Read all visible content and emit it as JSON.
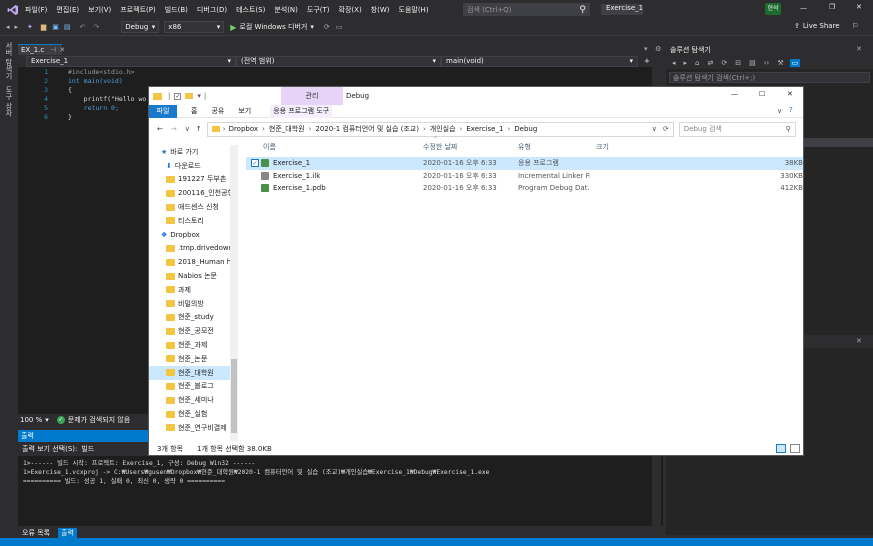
{
  "vs": {
    "menu": [
      "파일(F)",
      "편집(E)",
      "보기(V)",
      "프로젝트(P)",
      "빌드(B)",
      "디버그(D)",
      "테스트(S)",
      "분석(N)",
      "도구(T)",
      "확장(X)",
      "창(W)",
      "도움말(H)"
    ],
    "search_placeholder": "검색 (Ctrl+Q)",
    "solution_name": "Exercise_1",
    "user_badge": "현석",
    "live_share": "Live Share",
    "config": "Debug",
    "platform": "x86",
    "run_label": "로컬 Windows 디버거",
    "left_tabs": [
      "서버 탐색기",
      "도구 상자"
    ],
    "doc_tab": "EX_1.c",
    "nav_project": "Exercise_1",
    "nav_scope": "(전역 범위)",
    "nav_member": "main(void)",
    "line_numbers": [
      "1",
      "2",
      "3",
      "4",
      "5",
      "6"
    ],
    "code": [
      "#include<stdio.h>",
      "int main(void)",
      "{",
      "    printf(\"Hello wo",
      "    return 0;",
      "}"
    ],
    "zoom": "100 %",
    "issues": "문제가 검색되지 않음",
    "output_title": "출력",
    "output_source_label": "출력 보기 선택(S):",
    "output_source": "빌드",
    "output_lines": [
      "1>------ 빌드 시작: 프로젝트: Exercise_1, 구성: Debug Win32 ------",
      "1>Exercise_1.vcxproj -> C:₩Users₩gusen₩Dropbox₩현준_대학원₩2020-1 컴퓨터언어 및 실습 (조교)₩개인실습₩Exercise_1₩Debug₩Exercise_1.exe",
      "========== 빌드: 성공 1, 실패 0, 최신 0, 생략 0 =========="
    ],
    "bottom_tabs": [
      "오류 목록",
      "출력"
    ],
    "sol_title": "솔루션 탐색기",
    "sol_search": "솔루션 탐색기 검색(Ctrl+;)"
  },
  "explorer": {
    "title": "Debug",
    "context_tab": "관리",
    "context_sub": "응용 프로그램 도구",
    "ribbon_tabs": [
      "파일",
      "홈",
      "공유",
      "보기"
    ],
    "breadcrumb": [
      "Dropbox",
      "현준_대학원",
      "2020-1 컴퓨터언어 및 실습 (조교)",
      "개인실습",
      "Exercise_1",
      "Debug"
    ],
    "search_placeholder": "Debug 검색",
    "nav": [
      {
        "label": "바로 가기",
        "kind": "star"
      },
      {
        "label": "다운로드",
        "kind": "download"
      },
      {
        "label": "191227 두부촌",
        "kind": "folder"
      },
      {
        "label": "200116_인천공항",
        "kind": "folder"
      },
      {
        "label": "애드센스 신청",
        "kind": "folder"
      },
      {
        "label": "티스토리",
        "kind": "folder"
      },
      {
        "label": "Dropbox",
        "kind": "dropbox"
      },
      {
        "label": ".tmp.drivedownload",
        "kind": "folder"
      },
      {
        "label": "2018_Human hair",
        "kind": "folder"
      },
      {
        "label": "Nabios 논문",
        "kind": "folder"
      },
      {
        "label": "과제",
        "kind": "folder"
      },
      {
        "label": "비밀의방",
        "kind": "folder"
      },
      {
        "label": "현준_study",
        "kind": "folder"
      },
      {
        "label": "현준_공모전",
        "kind": "folder"
      },
      {
        "label": "현준_과제",
        "kind": "folder"
      },
      {
        "label": "현준_논문",
        "kind": "folder"
      },
      {
        "label": "현준_대학원",
        "kind": "folder"
      },
      {
        "label": "현준_블로그",
        "kind": "folder"
      },
      {
        "label": "현준_세미나",
        "kind": "folder"
      },
      {
        "label": "현준_실험",
        "kind": "folder"
      },
      {
        "label": "현준_연구비결제",
        "kind": "folder"
      }
    ],
    "columns": [
      "이름",
      "수정한 날짜",
      "유형",
      "크기"
    ],
    "files": [
      {
        "name": "Exercise_1",
        "date": "2020-01-16 오후 6:33",
        "type": "응용 프로그램",
        "size": "38KB"
      },
      {
        "name": "Exercise_1.ilk",
        "date": "2020-01-16 오후 6:33",
        "type": "Incremental Linker Fi...",
        "size": "330KB"
      },
      {
        "name": "Exercise_1.pdb",
        "date": "2020-01-16 오후 6:33",
        "type": "Program Debug Dat...",
        "size": "412KB"
      }
    ],
    "status_count": "3개 항목",
    "status_selected": "1개 항목 선택함 38.0KB"
  }
}
